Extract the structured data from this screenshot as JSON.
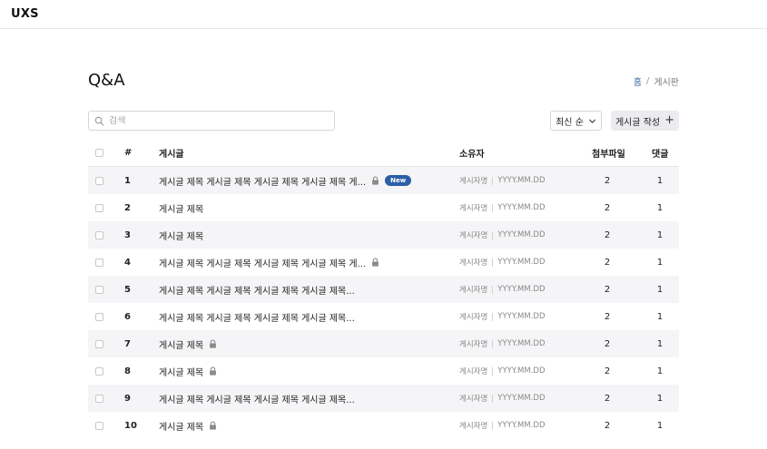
{
  "app": {
    "logo": "UXS"
  },
  "page": {
    "title": "Q&A"
  },
  "breadcrumb": {
    "home": "홈",
    "separator": "/",
    "current": "게시판"
  },
  "search": {
    "placeholder": "검색",
    "value": ""
  },
  "sort": {
    "label": "최신 순"
  },
  "write_button": {
    "label": "게시글 작성",
    "icon": "+"
  },
  "table": {
    "headers": {
      "number": "#",
      "title": "게시글",
      "owner": "소유자",
      "attachments": "첨부파일",
      "comments": "댓글"
    },
    "rows": [
      {
        "number": "1",
        "title": "게시글 제목 게시글 제목 게시글 제목 게시글 제목 게...",
        "locked": true,
        "badge": "New",
        "author": "게시자명",
        "date": "YYYY.MM.DD",
        "attachments": "2",
        "comments": "1"
      },
      {
        "number": "2",
        "title": "게시글 제목",
        "locked": false,
        "author": "게시자명",
        "date": "YYYY.MM.DD",
        "attachments": "2",
        "comments": "1"
      },
      {
        "number": "3",
        "title": "게시글 제목",
        "locked": false,
        "author": "게시자명",
        "date": "YYYY.MM.DD",
        "attachments": "2",
        "comments": "1"
      },
      {
        "number": "4",
        "title": "게시글 제목 게시글 제목 게시글 제목 게시글 제목 게...",
        "locked": true,
        "author": "게시자명",
        "date": "YYYY.MM.DD",
        "attachments": "2",
        "comments": "1"
      },
      {
        "number": "5",
        "title": "게시글 제목 게시글 제목 게시글 제목 게시글 제목...",
        "locked": false,
        "author": "게시자명",
        "date": "YYYY.MM.DD",
        "attachments": "2",
        "comments": "1"
      },
      {
        "number": "6",
        "title": "게시글 제목 게시글 제목 게시글 제목 게시글 제목...",
        "locked": false,
        "author": "게시자명",
        "date": "YYYY.MM.DD",
        "attachments": "2",
        "comments": "1"
      },
      {
        "number": "7",
        "title": "게시글 제목",
        "locked": true,
        "author": "게시자명",
        "date": "YYYY.MM.DD",
        "attachments": "2",
        "comments": "1"
      },
      {
        "number": "8",
        "title": "게시글 제목",
        "locked": true,
        "author": "게시자명",
        "date": "YYYY.MM.DD",
        "attachments": "2",
        "comments": "1"
      },
      {
        "number": "9",
        "title": "게시글 제목 게시글 제목 게시글 제목 게시글 제목...",
        "locked": false,
        "author": "게시자명",
        "date": "YYYY.MM.DD",
        "attachments": "2",
        "comments": "1"
      },
      {
        "number": "10",
        "title": "게시글 제목",
        "locked": true,
        "author": "게시자명",
        "date": "YYYY.MM.DD",
        "attachments": "2",
        "comments": "1"
      }
    ]
  },
  "colors": {
    "accent": "#2d5ea8",
    "stripe": "#f5f5f7",
    "border": "#e6e6e6"
  }
}
